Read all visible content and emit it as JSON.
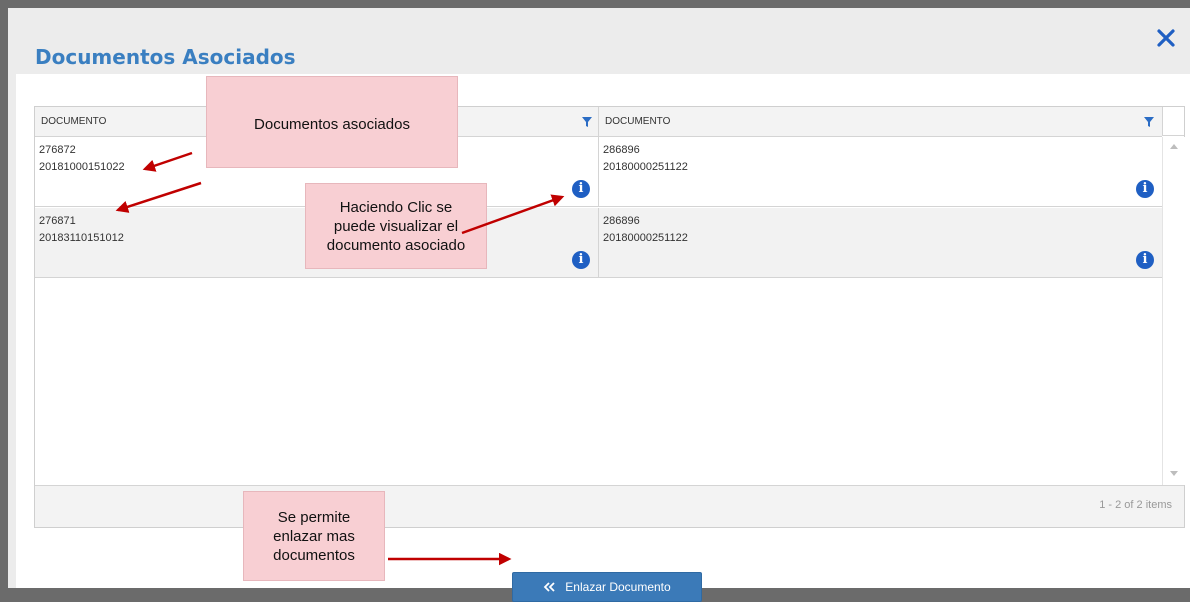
{
  "dialog": {
    "title": "Documentos Asociados",
    "close_icon": "close-icon"
  },
  "grid": {
    "columns": [
      {
        "label": "DOCUMENTO",
        "filter_icon": "filter-icon"
      },
      {
        "label": "DOCUMENTO",
        "filter_icon": "filter-icon"
      }
    ],
    "rows": [
      {
        "left": {
          "id": "276872",
          "number": "20181000151022"
        },
        "right": {
          "id": "286896",
          "number": "20180000251122"
        }
      },
      {
        "left": {
          "id": "276871",
          "number": "20183110151012"
        },
        "right": {
          "id": "286896",
          "number": "20180000251122"
        }
      }
    ],
    "info_icon_label": "i",
    "pager_info": "1 - 2 of 2 items"
  },
  "actions": {
    "link_button_label": "Enlazar Documento",
    "link_button_icon": "double-chevron-left-icon"
  },
  "annotations": {
    "associated_docs": "Documentos asociados",
    "click_to_view": [
      "Haciendo Clic se",
      "puede visualizar el",
      "documento asociado"
    ],
    "link_more": [
      "Se permite",
      "enlazar mas",
      "documentos"
    ]
  },
  "colors": {
    "title": "#3a7fc1",
    "primary_button": "#3b7ab8",
    "info_icon": "#1f5fc3",
    "callout": "#f8cfd3",
    "arrow": "#c00000"
  }
}
